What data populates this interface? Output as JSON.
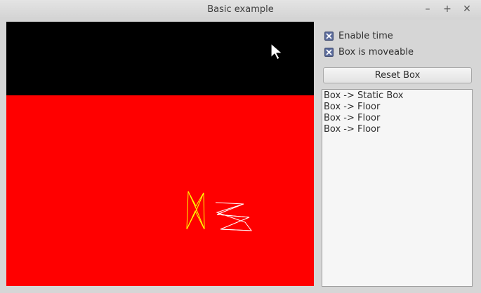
{
  "window": {
    "title": "Basic example",
    "minimize_glyph": "–",
    "maximize_glyph": "+",
    "close_glyph": "✕"
  },
  "viewport": {
    "sky_color": "#000000",
    "ground_color": "#ff0000",
    "box_outline_color": "#ffff00",
    "static_box_outline_color": "#ffffff"
  },
  "controls": {
    "enable_time": {
      "label": "Enable time",
      "checked": true
    },
    "box_moveable": {
      "label": "Box is moveable",
      "checked": true
    },
    "reset_button_label": "Reset Box"
  },
  "log": {
    "lines": [
      "Box -> Static Box",
      "Box -> Floor",
      "Box -> Floor",
      "Box -> Floor"
    ]
  }
}
